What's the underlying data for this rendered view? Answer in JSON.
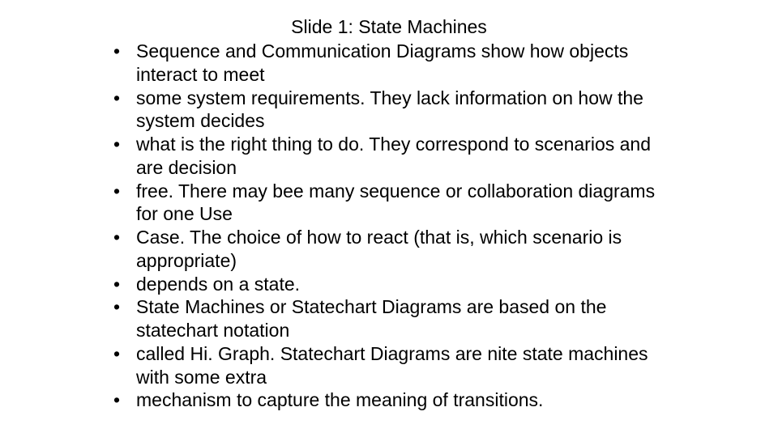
{
  "slide": {
    "title": "Slide 1: State Machines",
    "bullets": [
      " Sequence and Communication Diagrams show how objects interact to meet",
      "some system requirements. They lack information on how the system decides",
      "what is the right thing to do. They correspond to scenarios and are decision",
      "free. There may bee many sequence or collaboration diagrams for one Use",
      "Case. The choice of how to react (that is, which scenario is appropriate)",
      "depends on a state.",
      " State Machines or Statechart Diagrams are based on the statechart notation",
      "called Hi. Graph. Statechart Diagrams are nite state machines with some extra",
      "mechanism to capture the meaning of transitions."
    ]
  }
}
